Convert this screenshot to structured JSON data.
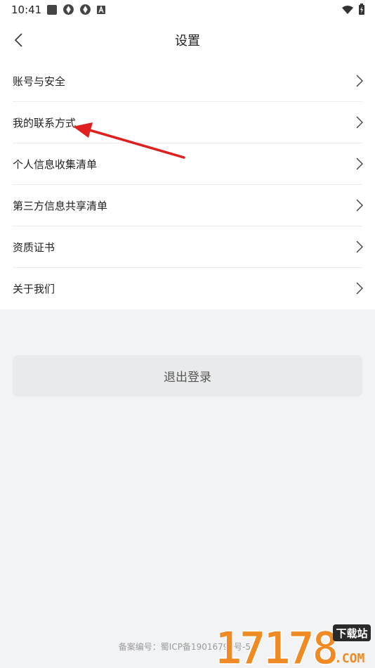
{
  "status_bar": {
    "time": "10:41"
  },
  "header": {
    "title": "设置"
  },
  "menu": {
    "items": [
      {
        "label": "账号与安全"
      },
      {
        "label": "我的联系方式"
      },
      {
        "label": "个人信息收集清单"
      },
      {
        "label": "第三方信息共享清单"
      },
      {
        "label": "资质证书"
      },
      {
        "label": "关于我们"
      }
    ]
  },
  "logout": {
    "label": "退出登录"
  },
  "footer": {
    "icp": "备案编号：蜀ICP备19016799号-5A"
  },
  "watermark": {
    "text": "17178",
    "badge": "下载站",
    "suffix": ".COM"
  },
  "colors": {
    "accent_arrow": "#e02020",
    "watermark_orange": "#f08a24"
  }
}
